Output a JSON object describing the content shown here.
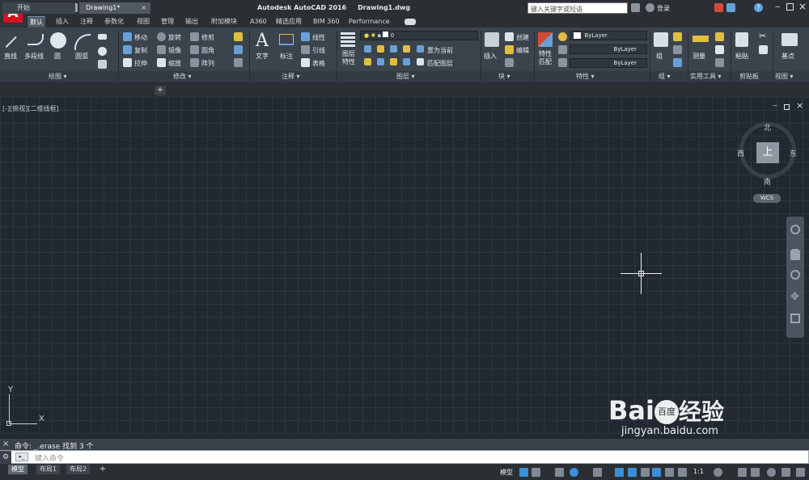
{
  "titlebar": {
    "app_title": "Autodesk AutoCAD 2016",
    "file_name": "Drawing1.dwg",
    "search_placeholder": "键入关键字或短语",
    "login_label": "登录",
    "help_label": "?"
  },
  "ribbon_tabs": [
    "默认",
    "插入",
    "注释",
    "参数化",
    "视图",
    "管理",
    "输出",
    "附加模块",
    "A360",
    "精选应用",
    "BIM 360",
    "Performance"
  ],
  "ribbon": {
    "draw": {
      "line": "直线",
      "polyline": "多段线",
      "circle": "圆",
      "arc": "圆弧",
      "panel": "绘图 ▾"
    },
    "modify": {
      "move": "移动",
      "rotate": "旋转",
      "trim": "修剪",
      "copy": "复制",
      "mirror": "镜像",
      "fillet": "圆角",
      "stretch": "拉伸",
      "scale": "缩放",
      "array": "阵列",
      "panel": "修改 ▾"
    },
    "annotation": {
      "text": "文字",
      "dimension": "标注",
      "linear": "线性",
      "leader": "引线",
      "table": "表格",
      "panel": "注释 ▾"
    },
    "layers": {
      "layer_props": "图层特性",
      "current_layer": "0",
      "set_current": "置为当前",
      "match_layer": "匹配图层",
      "panel": "图层 ▾"
    },
    "block": {
      "insert": "插入",
      "create": "创建",
      "edit": "编辑",
      "panel": "块 ▾"
    },
    "properties": {
      "match": "特性匹配",
      "color": "ByLayer",
      "linetype": "ByLayer",
      "lineweight": "ByLayer",
      "panel": "特性 ▾"
    },
    "groups": {
      "group": "组",
      "panel": "组 ▾"
    },
    "utilities": {
      "measure": "测量",
      "panel": "实用工具 ▾"
    },
    "clipboard": {
      "paste": "粘贴",
      "panel": "剪贴板"
    },
    "view": {
      "base": "基点",
      "panel": "视图 ▾"
    }
  },
  "doc_tabs": {
    "start": "开始",
    "drawing": "Drawing1*"
  },
  "viewport": {
    "label": "[-][俯视][二维线框]",
    "viewcube": {
      "top": "上",
      "north": "北",
      "south": "南",
      "east": "东",
      "west": "西",
      "wcs": "WCS"
    },
    "ucs_x": "X",
    "ucs_y": "Y"
  },
  "command": {
    "history": "命令:  _.erase 找到 3 个",
    "placeholder": "键入命令"
  },
  "layout_tabs": [
    "模型",
    "布局1",
    "布局2"
  ],
  "status": {
    "model": "模型",
    "scale": "1:1"
  },
  "watermark": {
    "brand": "Bai",
    "brand2": "百度",
    "cn": "经验",
    "url": "jingyan.baidu.com"
  }
}
